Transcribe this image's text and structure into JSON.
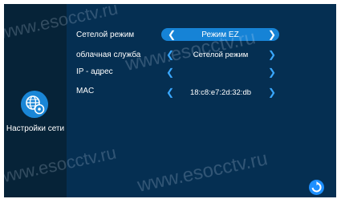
{
  "sidebar": {
    "label": "Настройки сети",
    "icon": "network-settings-icon"
  },
  "rows": [
    {
      "label": "Сетелой режим",
      "value": "Режим EZ"
    },
    {
      "label": "облачная служба",
      "value": "Сетелой режим"
    },
    {
      "label": "IP - адрес",
      "value": ""
    },
    {
      "label": "MAC",
      "value": "18:c8:e7:2d:32:db"
    }
  ],
  "watermark": "www.esocctv.ru",
  "colors": {
    "background": "#052f52",
    "sidebar": "#062338",
    "accent": "#1683d6",
    "chevron": "#3aa8ff"
  }
}
